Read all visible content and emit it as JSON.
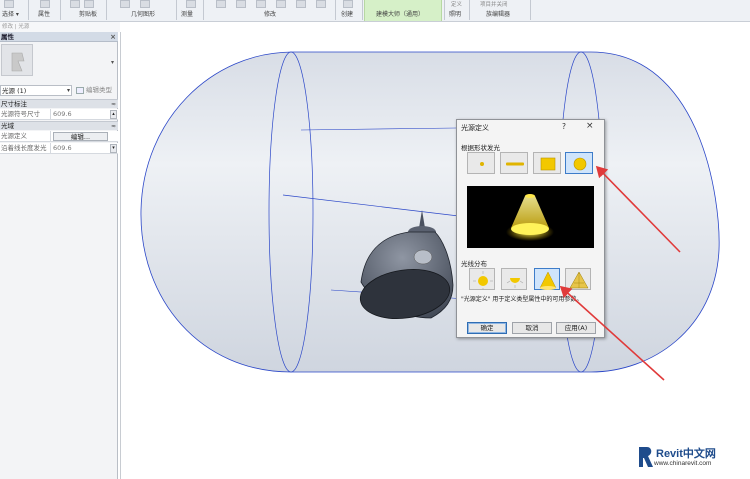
{
  "ribbon": {
    "labels": [
      "选择 ▾",
      "属性",
      "剪贴板",
      "几何图形",
      "测量",
      "修改",
      "创建",
      "建模大师（通用）",
      "照明",
      "族编辑器"
    ],
    "mini_labels": [
      "定义",
      "项目并关闭"
    ]
  },
  "path_bar": {
    "text": "修改 | 光源"
  },
  "properties": {
    "title": "属性",
    "close": "×",
    "type_selector": "光源 (1)",
    "edit_type": "编辑类型",
    "categories": [
      {
        "label": "尺寸标注",
        "toggle": "≈"
      },
      {
        "label": "光域",
        "toggle": "≈"
      }
    ],
    "rows": [
      {
        "key": "光源符号尺寸",
        "value": "609.6"
      },
      {
        "key": "光源定义",
        "value": "编辑..."
      },
      {
        "key": "沿着线长度发光",
        "value": "609.6"
      }
    ]
  },
  "dialog": {
    "title": "光源定义",
    "help": "?",
    "close": "×",
    "shape_section": "根据形状发光",
    "shapes": [
      "point-icon",
      "line-icon",
      "rectangle-icon",
      "circle-icon"
    ],
    "selected_shape": 3,
    "dist_section": "光线分布",
    "distributions": [
      "spherical-icon",
      "hemispherical-icon",
      "spot-icon",
      "photometric-web-icon"
    ],
    "selected_distribution": 2,
    "description": "\"光源定义\" 用于定义类型属性中的可用参数。",
    "ok": "确定",
    "cancel": "取消",
    "apply": "应用(A)"
  },
  "watermark": {
    "brand": "Revit中文网",
    "url": "www.chinarevit.com"
  },
  "colors": {
    "accent": "#3d7cc9",
    "annotation_arrow": "#e03a3a",
    "capsule_fill": "#dfe3ea",
    "wire": "#2a46c8"
  }
}
